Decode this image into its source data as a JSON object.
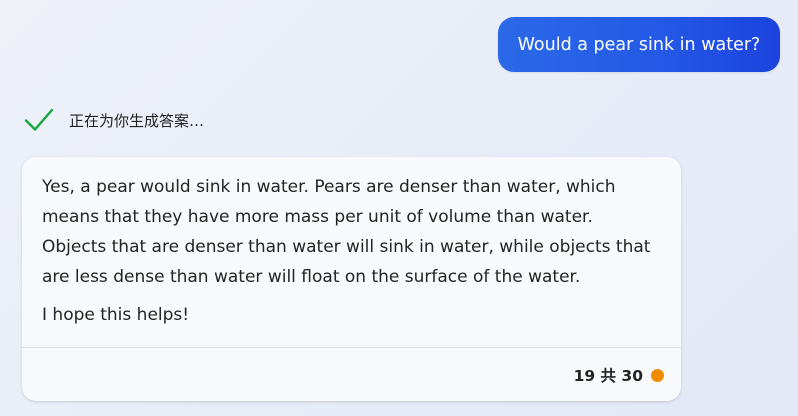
{
  "user_message": {
    "text": "Would a pear sink in water?"
  },
  "status": {
    "icon": "check-icon",
    "text": "正在为你生成答案…",
    "color": "#15a83f"
  },
  "answer": {
    "paragraphs": [
      "Yes, a pear would sink in water. Pears are denser than water, which means that they have more mass per unit of volume than water. Objects that are denser than water will sink in water, while objects that are less dense than water will float on the surface of the water.",
      "I hope this helps!"
    ]
  },
  "footer": {
    "turn_counter": "19 共 30",
    "indicator_color": "#f08c00"
  },
  "colors": {
    "user_bubble_start": "#2b69e8",
    "user_bubble_end": "#1c42de",
    "card_background": "#f7f9fd"
  }
}
